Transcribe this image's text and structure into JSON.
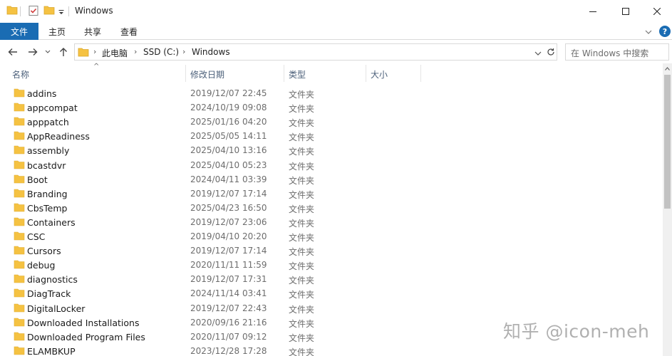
{
  "window": {
    "title": "Windows"
  },
  "ribbon": {
    "tabs": [
      "文件",
      "主页",
      "共享",
      "查看"
    ]
  },
  "address": {
    "crumbs": [
      "此电脑",
      "SSD (C:)",
      "Windows"
    ]
  },
  "search": {
    "placeholder": "在 Windows 中搜索"
  },
  "columns": {
    "name": "名称",
    "date": "修改日期",
    "type": "类型",
    "size": "大小"
  },
  "items": [
    {
      "name": "addins",
      "date": "2019/12/07 22:45",
      "type": "文件夹"
    },
    {
      "name": "appcompat",
      "date": "2024/10/19 09:08",
      "type": "文件夹"
    },
    {
      "name": "apppatch",
      "date": "2025/01/16 04:20",
      "type": "文件夹"
    },
    {
      "name": "AppReadiness",
      "date": "2025/05/05 14:11",
      "type": "文件夹"
    },
    {
      "name": "assembly",
      "date": "2025/04/10 13:16",
      "type": "文件夹"
    },
    {
      "name": "bcastdvr",
      "date": "2025/04/10 05:23",
      "type": "文件夹"
    },
    {
      "name": "Boot",
      "date": "2024/04/11 03:39",
      "type": "文件夹"
    },
    {
      "name": "Branding",
      "date": "2019/12/07 17:14",
      "type": "文件夹"
    },
    {
      "name": "CbsTemp",
      "date": "2025/04/23 16:50",
      "type": "文件夹"
    },
    {
      "name": "Containers",
      "date": "2019/12/07 23:06",
      "type": "文件夹"
    },
    {
      "name": "CSC",
      "date": "2019/04/10 20:20",
      "type": "文件夹"
    },
    {
      "name": "Cursors",
      "date": "2019/12/07 17:14",
      "type": "文件夹"
    },
    {
      "name": "debug",
      "date": "2020/11/11 11:59",
      "type": "文件夹"
    },
    {
      "name": "diagnostics",
      "date": "2019/12/07 17:31",
      "type": "文件夹"
    },
    {
      "name": "DiagTrack",
      "date": "2024/11/14 03:41",
      "type": "文件夹"
    },
    {
      "name": "DigitalLocker",
      "date": "2019/12/07 22:43",
      "type": "文件夹"
    },
    {
      "name": "Downloaded Installations",
      "date": "2020/09/16 21:16",
      "type": "文件夹"
    },
    {
      "name": "Downloaded Program Files",
      "date": "2020/11/07 09:12",
      "type": "文件夹"
    },
    {
      "name": "ELAMBKUP",
      "date": "2023/12/28 17:28",
      "type": "文件夹"
    }
  ],
  "watermark": "知乎 @icon-meh",
  "colors": {
    "accent": "#1a6cb3",
    "folder": "#f5c242",
    "header_text": "#4c607a"
  }
}
